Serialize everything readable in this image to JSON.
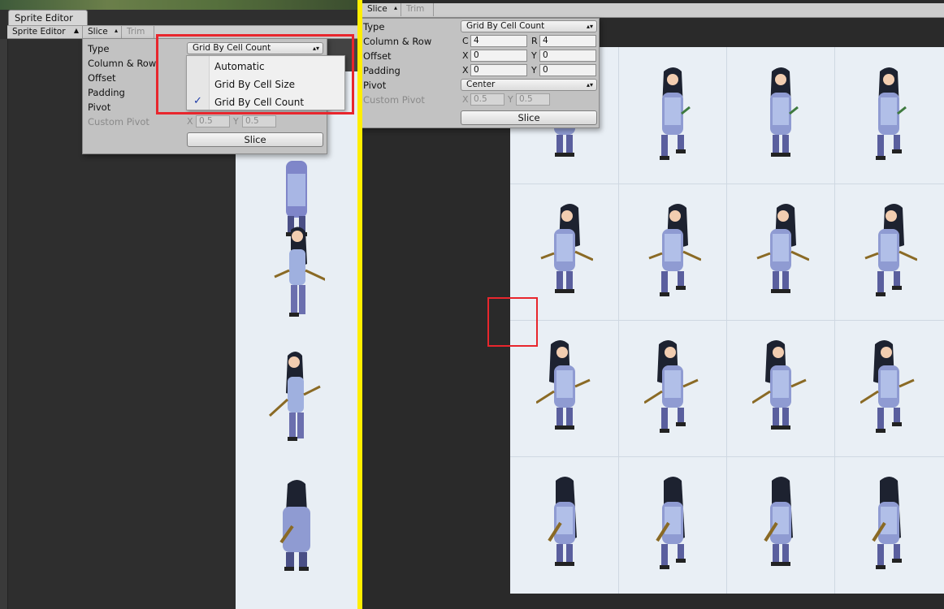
{
  "left": {
    "window_tab": "Sprite Editor",
    "toolbar": {
      "sprite_editor_label": "Sprite Editor",
      "slice_label": "Slice",
      "trim_label": "Trim"
    },
    "slice_panel": {
      "type_label": "Type",
      "type_value": "Grid By Cell Count",
      "column_row_label": "Column & Row",
      "offset_label": "Offset",
      "padding_label": "Padding",
      "pivot_label": "Pivot",
      "custom_pivot_label": "Custom Pivot",
      "x_label": "X",
      "y_label": "Y",
      "custom_pivot_x": "0.5",
      "custom_pivot_y": "0.5",
      "slice_button": "Slice"
    },
    "type_dropdown": {
      "options": [
        "Automatic",
        "Grid By Cell Size",
        "Grid By Cell Count"
      ],
      "selected": "Grid By Cell Count",
      "check_glyph": "✓"
    }
  },
  "right": {
    "toolbar": {
      "slice_label": "Slice",
      "trim_label": "Trim"
    },
    "slice_panel": {
      "type_label": "Type",
      "type_value": "Grid By Cell Count",
      "column_row_label": "Column & Row",
      "c_label": "C",
      "r_label": "R",
      "columns": "4",
      "rows": "4",
      "offset_label": "Offset",
      "offset_x": "0",
      "offset_y": "0",
      "padding_label": "Padding",
      "padding_x": "0",
      "padding_y": "0",
      "x_label": "X",
      "y_label": "Y",
      "pivot_label": "Pivot",
      "pivot_value": "Center",
      "custom_pivot_label": "Custom Pivot",
      "custom_pivot_x": "0.5",
      "custom_pivot_y": "0.5",
      "slice_button": "Slice"
    }
  },
  "colors": {
    "highlight": "#e8262d",
    "divider": "#ffee00",
    "canvas_bg": "#e9eff5",
    "checkmark": "#1f3ca8"
  }
}
